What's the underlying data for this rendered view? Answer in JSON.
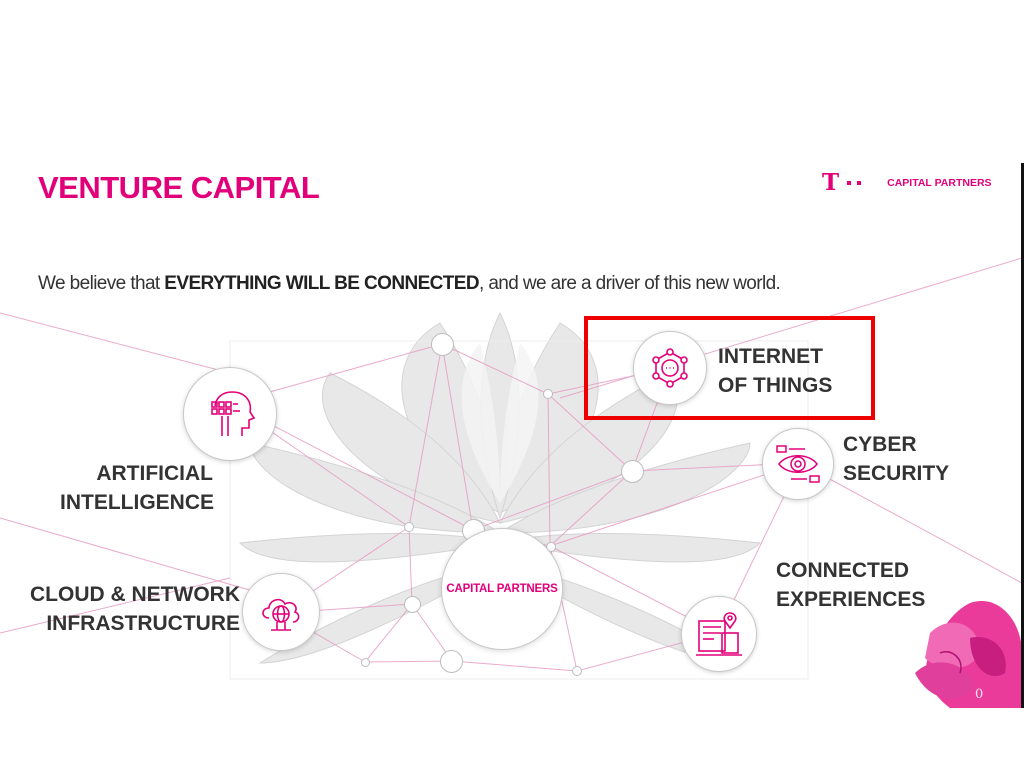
{
  "slide": {
    "title": "VENTURE CAPITAL",
    "logo": {
      "mark": "T",
      "text": "CAPITAL PARTNERS"
    },
    "tagline": {
      "before": "We believe that ",
      "emphasis": "EVERYTHING WILL BE CONNECTED",
      "after": ", and we are a driver of this new world."
    },
    "center_label": "CAPITAL PARTNERS",
    "focus_areas": [
      {
        "line1": "INTERNET",
        "line2": "OF THINGS",
        "icon": "molecule-icon"
      },
      {
        "line1": "CYBER",
        "line2": "SECURITY",
        "icon": "eye-scan-icon"
      },
      {
        "line1": "ARTIFICIAL",
        "line2": "INTELLIGENCE",
        "icon": "head-circuit-icon"
      },
      {
        "line1": "CONNECTED",
        "line2": "EXPERIENCES",
        "icon": "city-pin-icon"
      },
      {
        "line1": "CLOUD & NETWORK",
        "line2": "INFRASTRUCTURE",
        "icon": "cloud-globe-icon"
      }
    ],
    "page_number": "0",
    "highlight_target": "INTERNET OF THINGS"
  },
  "colors": {
    "brand_magenta": "#e2007a",
    "text_gray": "#333333",
    "highlight_red": "#ee0000",
    "line_pink": "#e79cc4"
  }
}
